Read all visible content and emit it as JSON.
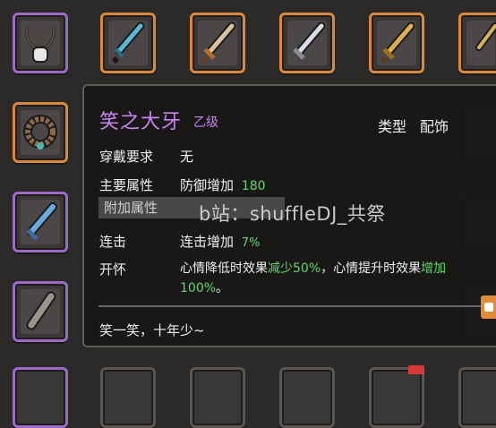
{
  "tooltip": {
    "name": "笑之大牙",
    "grade": "乙级",
    "type_label": "类型",
    "type_value": "配饰",
    "requirement_label": "穿戴要求",
    "requirement_value": "无",
    "main_attr_label": "主要属性",
    "main_attr_text": "防御增加",
    "main_attr_value": "180",
    "add_attr_label": "附加属性",
    "combo_label": "连击",
    "combo_text": "连击增加",
    "combo_value": "7%",
    "effect_label": "开怀",
    "effect_part1": "心情降低时效果",
    "effect_part2": "减少50%",
    "effect_part3": "，心情提升时效果",
    "effect_part4": "增加100%",
    "effect_part5": "。",
    "flavor_text": "笑一笑，十年少~"
  },
  "watermark": "b站：shuffleDJ_共祭",
  "colors": {
    "purple_rarity": "#c884f0",
    "green_value": "#5fd86a",
    "orange_rarity": "#d88a3a",
    "slot_purple": "#9a6cc8"
  },
  "icons": {
    "items": [
      "necklace-icon",
      "teal-sword-icon",
      "bronze-sword-icon",
      "steel-sword-icon",
      "gold-sword-icon",
      "bead-bracelet-icon",
      "blue-sword-icon",
      "bone-flute-icon"
    ]
  }
}
